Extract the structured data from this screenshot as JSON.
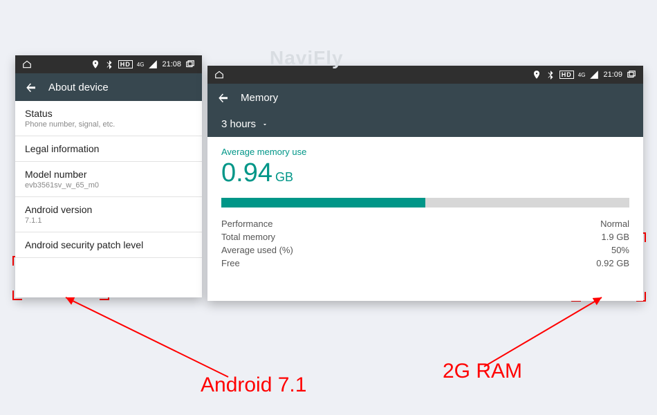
{
  "watermark": "NaviFly",
  "statusbar": {
    "time_left": "21:08",
    "time_right": "21:09",
    "hd": "HD",
    "net": "4G"
  },
  "left_panel": {
    "title": "About device",
    "items": [
      {
        "title": "Status",
        "subtitle": "Phone number, signal, etc."
      },
      {
        "title": "Legal information",
        "subtitle": ""
      },
      {
        "title": "Model number",
        "subtitle": "evb3561sv_w_65_m0"
      },
      {
        "title": "Android version",
        "subtitle": "7.1.1"
      },
      {
        "title": "Android security patch level",
        "subtitle": ""
      }
    ]
  },
  "right_panel": {
    "title": "Memory",
    "range": "3 hours",
    "avg_label": "Average memory use",
    "avg_value": "0.94",
    "avg_unit": "GB",
    "bar_fill_pct": 50,
    "stats": {
      "performance_label": "Performance",
      "performance_value": "Normal",
      "total_label": "Total memory",
      "total_value": "1.9 GB",
      "avgpct_label": "Average used (%)",
      "avgpct_value": "50%",
      "free_label": "Free",
      "free_value": "0.92 GB"
    }
  },
  "annotations": {
    "android_caption": "Android 7.1",
    "ram_caption": "2G RAM"
  }
}
